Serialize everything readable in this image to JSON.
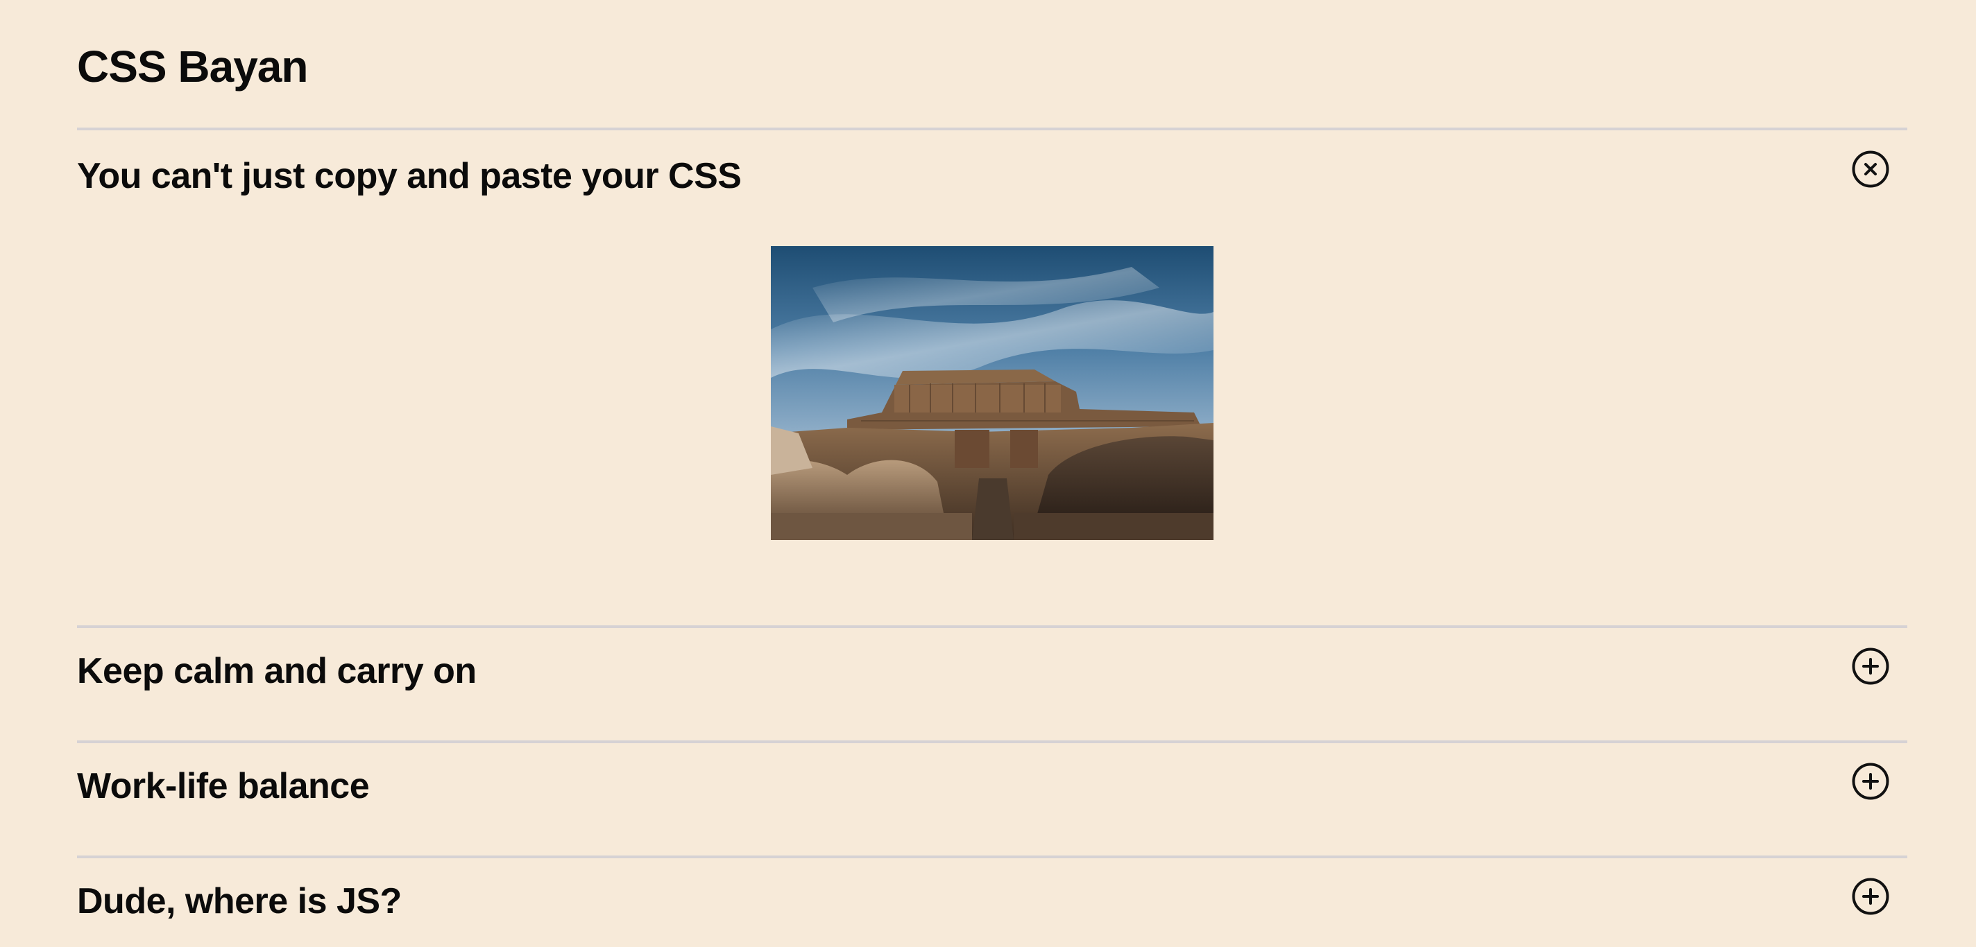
{
  "page": {
    "title": "CSS Bayan"
  },
  "accordion": {
    "items": [
      {
        "title": "You can't just copy and paste your CSS",
        "state": "open",
        "icon": "close-circle-icon"
      },
      {
        "title": "Keep calm and carry on",
        "state": "closed",
        "icon": "plus-circle-icon"
      },
      {
        "title": "Work-life balance",
        "state": "closed",
        "icon": "plus-circle-icon"
      },
      {
        "title": "Dude, where is JS?",
        "state": "closed",
        "icon": "plus-circle-icon"
      }
    ]
  },
  "colors": {
    "background": "#f7ead9",
    "text": "#0b0b0b",
    "divider": "#d6d2d4"
  }
}
